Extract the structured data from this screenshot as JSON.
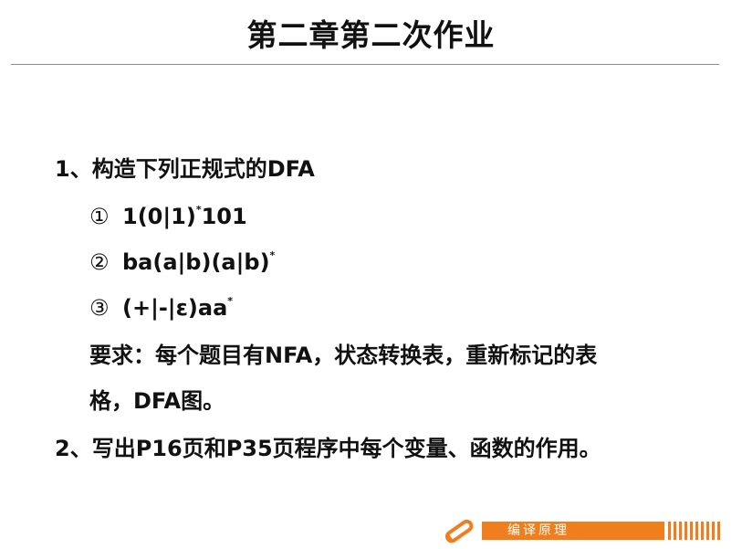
{
  "title": "第二章第二次作业",
  "q1": {
    "number": "1、",
    "text": "构造下列正规式的DFA",
    "items": [
      {
        "marker": "①",
        "expr": "1(0|1)",
        "sup": "*",
        "tail": "101"
      },
      {
        "marker": "②",
        "expr": "ba(a|b)(a|b)",
        "sup": "*",
        "tail": ""
      },
      {
        "marker": "③",
        "expr": "(+|-|ε)aa",
        "sup": "*",
        "tail": ""
      }
    ],
    "requirement_line1": "要求：每个题目有NFA，状态转换表，重新标记的表",
    "requirement_line2": "格，DFA图。"
  },
  "q2": {
    "number": "2、",
    "text": "写出P16页和P35页程序中每个变量、函数的作用。"
  },
  "footer": {
    "label": "编译原理",
    "accent_color": "#f07e1c",
    "icon": "pencil-icon"
  }
}
